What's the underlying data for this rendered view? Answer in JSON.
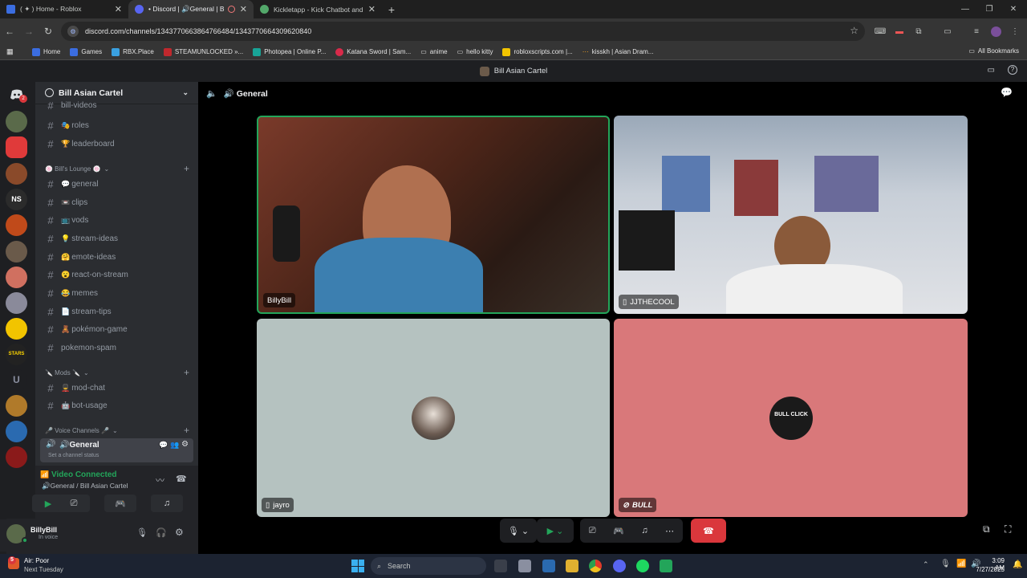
{
  "browser": {
    "tabs": [
      {
        "title": "( ✦ ) Home - Roblox",
        "active": false
      },
      {
        "title": "• Discord | 🔊General | Bill",
        "active": true
      },
      {
        "title": "Kickletapp - Kick Chatbot and",
        "active": false
      }
    ],
    "url": "discord.com/channels/1343770663864766484/1343770664309620840",
    "bookmarks": [
      "Home",
      "Games",
      "RBX.Place",
      "STEAMUNLOCKED »...",
      "Photopea | Online P...",
      "Katana Sword | Sam...",
      "anime",
      "hello kitty",
      "robloxscripts.com |...",
      "kisskh | Asian Dram..."
    ],
    "all_bookmarks": "All Bookmarks"
  },
  "discord": {
    "window_title": "Bill Asian Cartel",
    "server_name": "Bill Asian Cartel",
    "channels_top": [
      {
        "name": "bill-videos",
        "emoji": ""
      },
      {
        "name": "roles",
        "emoji": "🎭"
      },
      {
        "name": "leaderboard",
        "emoji": "🏆"
      }
    ],
    "category_lounge": "🍥 Bill's Lounge 🍥",
    "channels_lounge": [
      {
        "name": "general",
        "emoji": "💬"
      },
      {
        "name": "clips",
        "emoji": "📼"
      },
      {
        "name": "vods",
        "emoji": "📺"
      },
      {
        "name": "stream-ideas",
        "emoji": "💡"
      },
      {
        "name": "emote-ideas",
        "emoji": "🤗"
      },
      {
        "name": "react-on-stream",
        "emoji": "😮"
      },
      {
        "name": "memes",
        "emoji": "😂"
      },
      {
        "name": "stream-tips",
        "emoji": "📄"
      },
      {
        "name": "pokémon-game",
        "emoji": "🧸"
      },
      {
        "name": "pokemon-spam",
        "emoji": ""
      }
    ],
    "category_mods": "🔪 Mods 🔪",
    "channels_mods": [
      {
        "name": "mod-chat",
        "emoji": "💂"
      },
      {
        "name": "bot-usage",
        "emoji": "🤖"
      }
    ],
    "category_voice": "🎤 Voice Channels 🎤",
    "voice_channel": "🔊General",
    "voice_status_placeholder": "Set a channel status",
    "connection_status": "Video Connected",
    "connection_detail": "🔊General / Bill Asian Cartel",
    "user_name": "BillyBill",
    "user_status": "In voice",
    "main_channel": "🔊 General",
    "participants": [
      {
        "name": "BillyBill",
        "speaking": true
      },
      {
        "name": "JJTHECOOL",
        "speaking": false
      },
      {
        "name": "jayro",
        "speaking": false
      },
      {
        "name": "BULL",
        "speaking": false
      }
    ],
    "bull_avatar_text": "BULL CLICK"
  },
  "taskbar": {
    "weather_title": "Air: Poor",
    "weather_sub": "Next Tuesday",
    "weather_badge": "5",
    "search": "Search",
    "time": "3:09 AM",
    "date": "7/27/2025"
  },
  "colors": {
    "discord_blurple": "#5865f2",
    "voice_green": "#23a55a",
    "end_call_red": "#da373c",
    "jayro_tile": "#b5c2c0",
    "bull_tile": "#d9787a"
  }
}
